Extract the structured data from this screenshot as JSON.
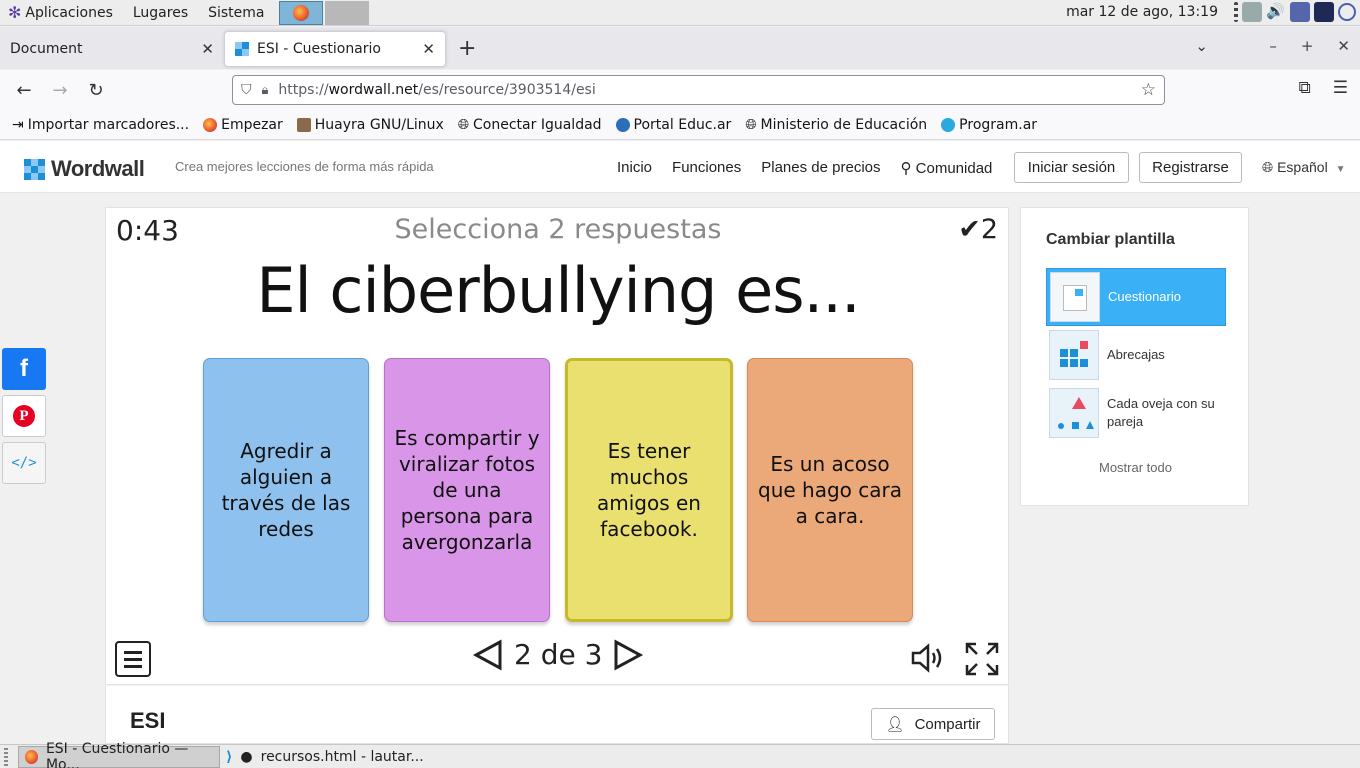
{
  "panel": {
    "menu": [
      "Aplicaciones",
      "Lugares",
      "Sistema"
    ],
    "clock": "mar 12 de ago, 13:19"
  },
  "tabs": [
    {
      "title": "Document"
    },
    {
      "title": "ESI - Cuestionario"
    }
  ],
  "url": {
    "prefix": "https://",
    "host": "wordwall.net",
    "path": "/es/resource/3903514/esi"
  },
  "bookmarks": [
    "Importar marcadores...",
    "Empezar",
    "Huayra GNU/Linux",
    "Conectar Igualdad",
    "Portal Educ.ar",
    "Ministerio de Educación",
    "Program.ar"
  ],
  "site": {
    "logo": "Wordwall",
    "tagline": "Crea mejores lecciones de forma más rápida",
    "nav": [
      "Inicio",
      "Funciones",
      "Planes de precios",
      "Comunidad"
    ],
    "login": "Iniciar sesión",
    "register": "Registrarse",
    "language": "Español"
  },
  "game": {
    "timer": "0:43",
    "instruction": "Selecciona 2 respuestas",
    "score": "2",
    "question": "El ciberbullying es...",
    "answers": [
      {
        "text": "Agredir a alguien a través de las redes",
        "color": "#8fc1ef",
        "border": "#5f9fd9"
      },
      {
        "text": "Es compartir y viralizar fotos de una persona para avergonzarla",
        "color": "#d996e8",
        "border": "#b86fcb"
      },
      {
        "text": "Es tener muchos amigos en facebook.",
        "color": "#e9e070",
        "border": "#c7b92c"
      },
      {
        "text": "Es un acoso que hago cara a cara.",
        "color": "#eba878",
        "border": "#d98a54"
      }
    ],
    "pager": "2 de 3"
  },
  "activity": {
    "title": "ESI",
    "share": "Compartir"
  },
  "templates": {
    "header": "Cambiar plantilla",
    "items": [
      {
        "label": "Cuestionario"
      },
      {
        "label": "Abrecajas"
      },
      {
        "label": "Cada oveja con su pareja"
      }
    ],
    "show_all": "Mostrar todo"
  },
  "taskbar": [
    "ESI - Cuestionario — Mo...",
    "recursos.html - lautar..."
  ],
  "colors": {
    "accent": "#3ab1f7",
    "facebook": "#1877f2"
  }
}
